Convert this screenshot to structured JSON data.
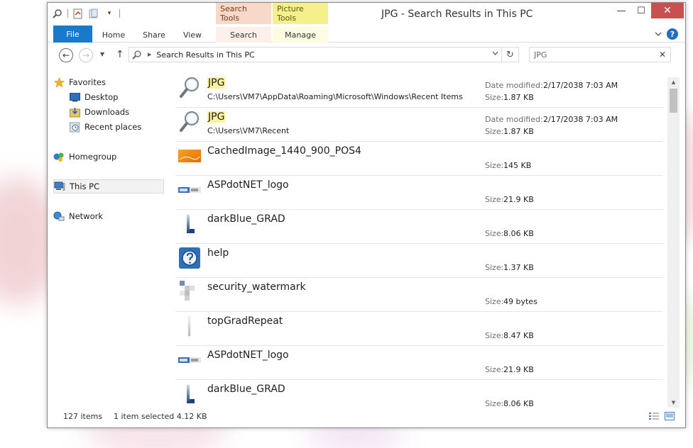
{
  "window": {
    "title": "JPG - Search Results in This PC",
    "min": "—",
    "max": "☐",
    "close": "✕"
  },
  "quick_access": {
    "icons": [
      "search-icon",
      "properties-icon",
      "new-folder-icon",
      "customize-dropdown-icon"
    ]
  },
  "context_tabs": {
    "search_tools": "Search Tools",
    "picture_tools": "Picture Tools"
  },
  "ribbon": {
    "tabs": [
      "File",
      "Home",
      "Share",
      "View",
      "Search",
      "Manage"
    ],
    "expand_icon": "chevron-down-icon",
    "help": "?"
  },
  "navigation": {
    "back": "←",
    "forward": "→",
    "recent": "▼",
    "up": "↑"
  },
  "address": {
    "path": "Search Results in This PC",
    "refresh": "↻"
  },
  "search": {
    "value": "JPG",
    "clear": "✕"
  },
  "nav_pane": {
    "items": [
      {
        "label": "Favorites",
        "icon": "star-icon"
      },
      {
        "label": "Desktop",
        "icon": "desktop-icon"
      },
      {
        "label": "Downloads",
        "icon": "downloads-icon"
      },
      {
        "label": "Recent places",
        "icon": "recent-places-icon"
      },
      {
        "label": "Homegroup",
        "icon": "homegroup-icon"
      },
      {
        "label": "This PC",
        "icon": "computer-icon",
        "selected": true
      },
      {
        "label": "Network",
        "icon": "network-icon"
      }
    ]
  },
  "results": {
    "date_label": "Date modified:",
    "size_label": "Size:",
    "items": [
      {
        "name": "JPG",
        "path": "C:\\Users\\VM7\\AppData\\Roaming\\Microsoft\\Windows\\Recent Items",
        "date": "2/17/2038 7:03 AM",
        "size": "1.87 KB",
        "icon": "search-shortcut-icon",
        "highlight": true
      },
      {
        "name": "JPG",
        "path": "C:\\Users\\VM7\\Recent",
        "date": "2/17/2038 7:03 AM",
        "size": "1.87 KB",
        "icon": "search-shortcut-icon",
        "highlight": true
      },
      {
        "name": "CachedImage_1440_900_POS4",
        "size": "145 KB",
        "icon": "image-thumbnail-icon"
      },
      {
        "name": "ASPdotNET_logo",
        "size": "21.9 KB",
        "icon": "aspnet-logo-icon"
      },
      {
        "name": "darkBlue_GRAD",
        "size": "8.06 KB",
        "icon": "gradient-bar-icon"
      },
      {
        "name": "help",
        "size": "1.37 KB",
        "icon": "help-image-icon"
      },
      {
        "name": "security_watermark",
        "size": "49 bytes",
        "icon": "watermark-thumbnail-icon"
      },
      {
        "name": "topGradRepeat",
        "size": "8.47 KB",
        "icon": "thin-gradient-icon"
      },
      {
        "name": "ASPdotNET_logo",
        "size": "21.9 KB",
        "icon": "aspnet-logo-icon"
      },
      {
        "name": "darkBlue_GRAD",
        "size": "8.06 KB",
        "icon": "gradient-bar-icon"
      }
    ]
  },
  "status": {
    "count": "127 items",
    "selection": "1 item selected  4.12 KB"
  },
  "view_buttons": {
    "details": "details-view-icon",
    "large_icons": "large-icons-view-icon"
  },
  "colors": {
    "file_tab": "#1979ca",
    "search_tools": "#f8d8c8",
    "picture_tools": "#f5f08c",
    "close_button": "#c75050",
    "highlight": "#fff29e"
  }
}
